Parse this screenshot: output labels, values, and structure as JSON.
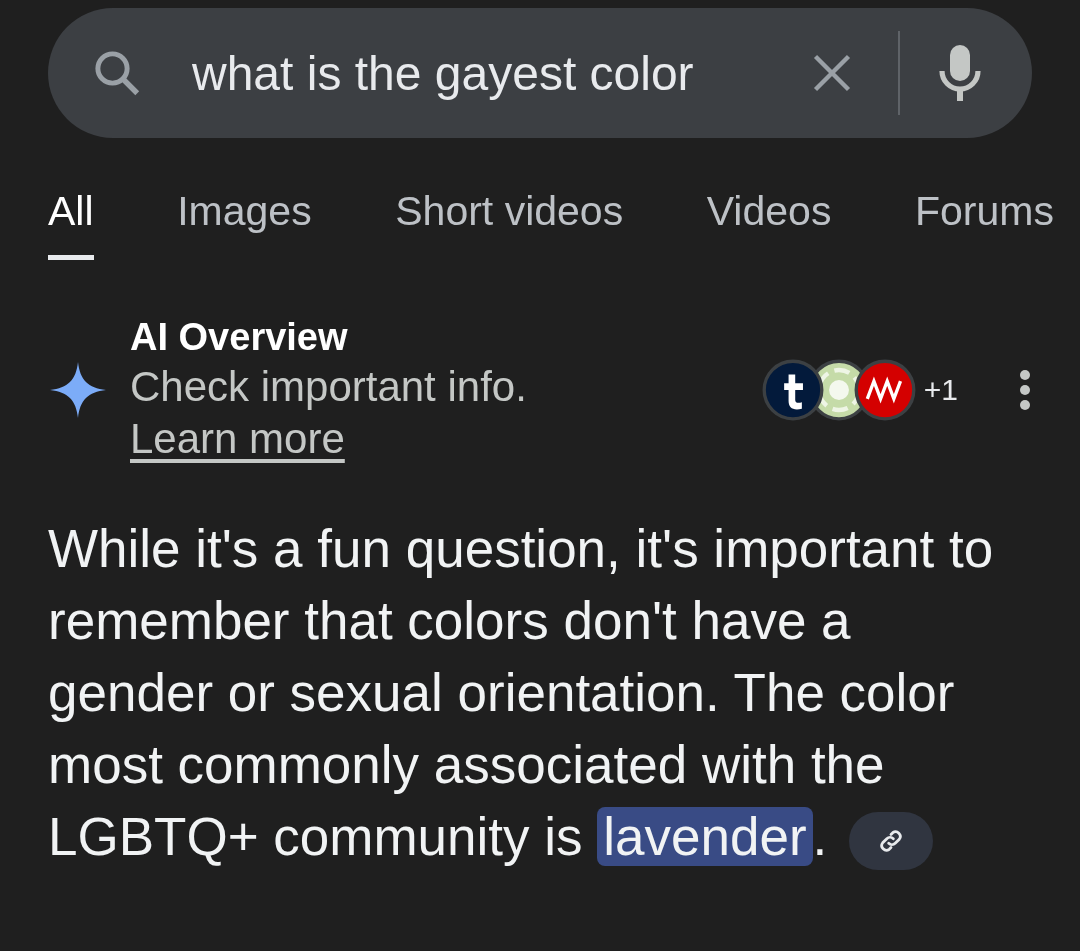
{
  "search": {
    "value": "what is the gayest color"
  },
  "tabs": [
    {
      "label": "All",
      "selected": true
    },
    {
      "label": "Images",
      "selected": false
    },
    {
      "label": "Short videos",
      "selected": false
    },
    {
      "label": "Videos",
      "selected": false
    },
    {
      "label": "Forums",
      "selected": false
    }
  ],
  "ai_overview": {
    "title": "AI Overview",
    "notice": "Check important info.",
    "learn_more": "Learn more",
    "sources": [
      {
        "kind": "tumblr"
      },
      {
        "kind": "spiral"
      },
      {
        "kind": "news"
      }
    ],
    "more_sources": "+1",
    "answer": {
      "before": "While it's a fun question, it's important to remember that colors don't have a gender or sexual orientation. The color most commonly associated with the LGBTQ+ community is ",
      "highlight": "lavender",
      "after": "."
    }
  }
}
